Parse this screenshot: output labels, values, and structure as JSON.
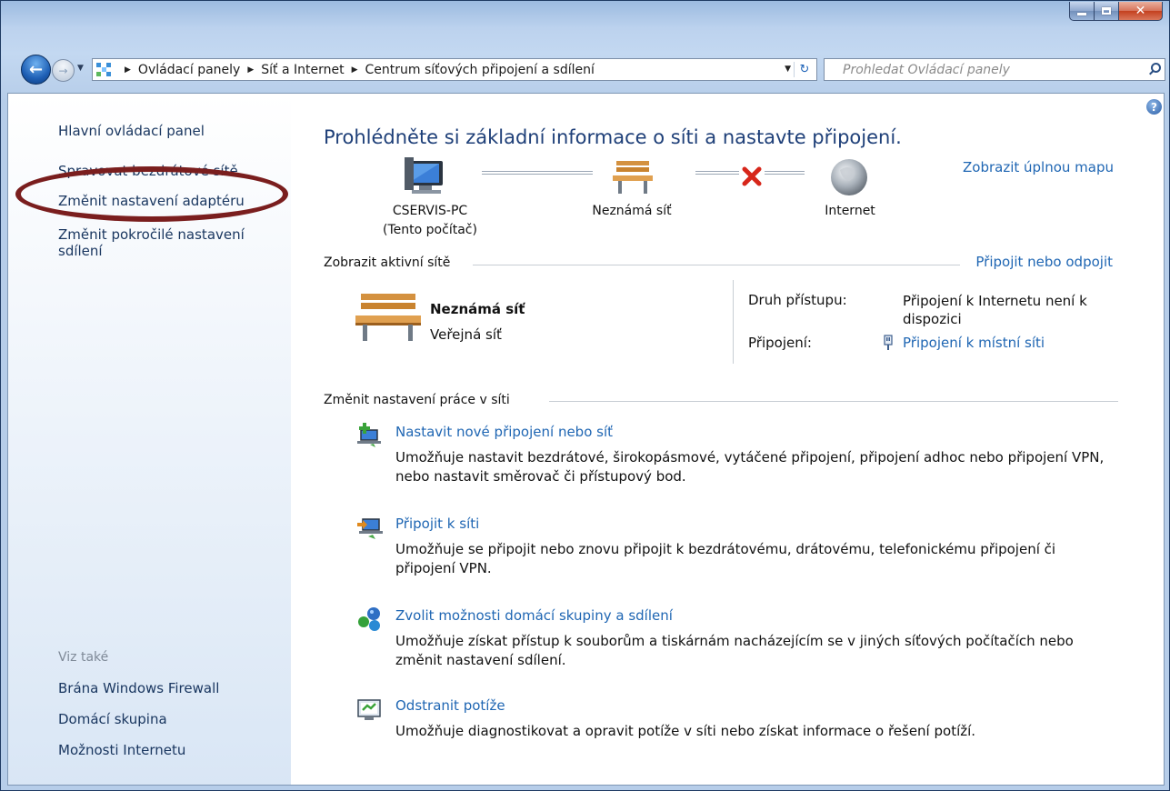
{
  "nav": {
    "breadcrumb": [
      "Ovládací panely",
      "Síť a Internet",
      "Centrum síťových připojení a sdílení"
    ],
    "search_placeholder": "Prohledat Ovládací panely"
  },
  "sidebar": {
    "home": "Hlavní ovládací panel",
    "links": [
      "Spravovat bezdrátové sítě",
      "Změnit nastavení adaptéru",
      "Změnit pokročilé nastavení sdílení"
    ],
    "see_also_label": "Viz také",
    "see_also": [
      "Brána Windows Firewall",
      "Domácí skupina",
      "Možnosti Internetu"
    ]
  },
  "main": {
    "title": "Prohlédněte si základní informace o síti a nastavte připojení.",
    "full_map_link": "Zobrazit úplnou mapu",
    "map": {
      "computer_name": "CSERVIS-PC",
      "computer_note": "(Tento počítač)",
      "network": "Neznámá síť",
      "internet": "Internet"
    },
    "active": {
      "header": "Zobrazit aktivní sítě",
      "connect_link": "Připojit nebo odpojit",
      "network_name": "Neznámá síť",
      "network_type": "Veřejná síť",
      "access_label": "Druh přístupu:",
      "access_value": "Připojení k Internetu není k dispozici",
      "connections_label": "Připojení:",
      "connections_value": "Připojení k místní síti"
    },
    "change": {
      "header": "Změnit nastavení práce v síti",
      "tasks": [
        {
          "link": "Nastavit nové připojení nebo síť",
          "desc": "Umožňuje nastavit bezdrátové, širokopásmové, vytáčené připojení, připojení adhoc nebo připojení VPN, nebo nastavit směrovač či přístupový bod.",
          "icon": "new-connection-icon"
        },
        {
          "link": "Připojit k síti",
          "desc": "Umožňuje se připojit nebo znovu připojit k bezdrátovému, drátovému, telefonickému připojení či připojení VPN.",
          "icon": "connect-network-icon"
        },
        {
          "link": "Zvolit možnosti domácí skupiny a sdílení",
          "desc": "Umožňuje získat přístup k souborům a tiskárnám nacházejícím se v jiných síťových počítačích nebo změnit nastavení sdílení.",
          "icon": "homegroup-icon"
        },
        {
          "link": "Odstranit potíže",
          "desc": "Umožňuje diagnostikovat a opravit potíže v síti nebo získat informace o řešení potíží.",
          "icon": "troubleshoot-icon"
        }
      ]
    }
  },
  "colors": {
    "link": "#1f66b3",
    "title": "#1e3f78",
    "highlight_ellipse": "#7a1e1e"
  }
}
